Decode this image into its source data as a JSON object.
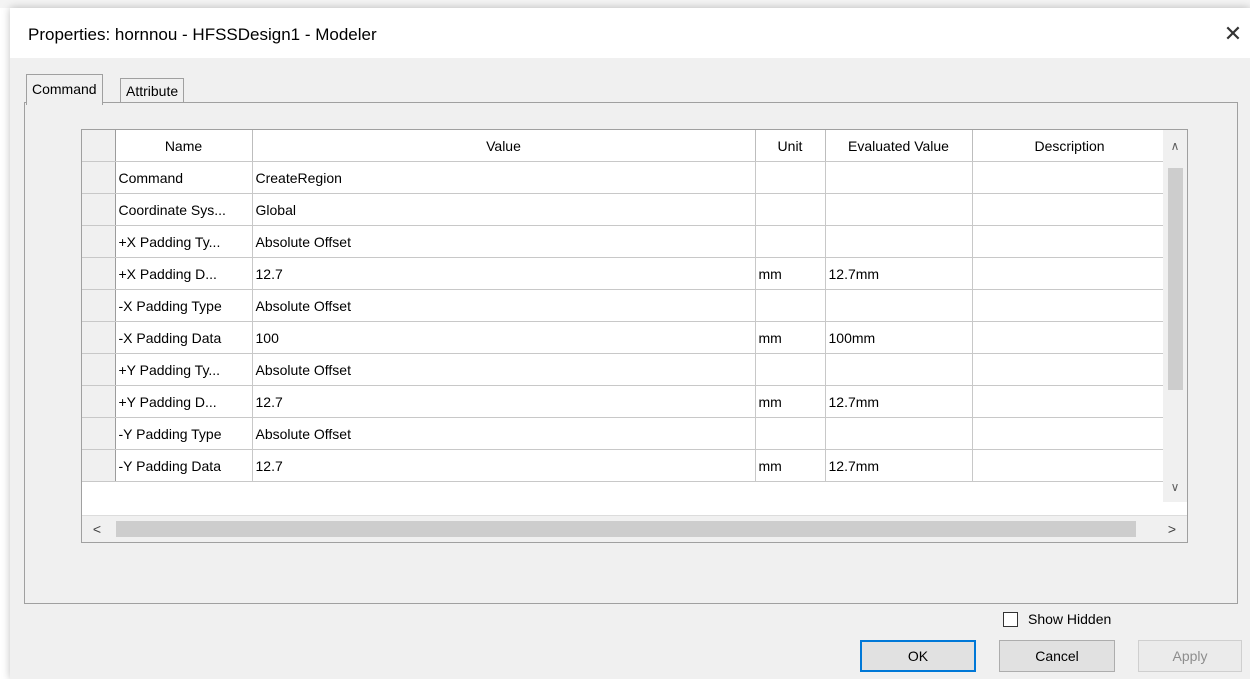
{
  "window": {
    "title": "Properties: hornnou - HFSSDesign1 - Modeler",
    "close_glyph": "✕"
  },
  "tabs": [
    {
      "label": "Command",
      "active": true
    },
    {
      "label": "Attribute",
      "active": false
    }
  ],
  "grid": {
    "columns": [
      "Name",
      "Value",
      "Unit",
      "Evaluated Value",
      "Description"
    ],
    "rows": [
      {
        "name": "Command",
        "value": "CreateRegion",
        "unit": "",
        "evaluated": "",
        "description": ""
      },
      {
        "name": "Coordinate Sys...",
        "value": "Global",
        "unit": "",
        "evaluated": "",
        "description": ""
      },
      {
        "name": "+X Padding Ty...",
        "value": "Absolute Offset",
        "unit": "",
        "evaluated": "",
        "description": ""
      },
      {
        "name": "+X Padding D...",
        "value": "12.7",
        "unit": "mm",
        "evaluated": "12.7mm",
        "description": ""
      },
      {
        "name": "-X Padding Type",
        "value": "Absolute Offset",
        "unit": "",
        "evaluated": "",
        "description": ""
      },
      {
        "name": "-X Padding Data",
        "value": "100",
        "unit": "mm",
        "evaluated": "100mm",
        "description": ""
      },
      {
        "name": "+Y Padding Ty...",
        "value": "Absolute Offset",
        "unit": "",
        "evaluated": "",
        "description": ""
      },
      {
        "name": "+Y Padding D...",
        "value": "12.7",
        "unit": "mm",
        "evaluated": "12.7mm",
        "description": ""
      },
      {
        "name": "-Y Padding Type",
        "value": "Absolute Offset",
        "unit": "",
        "evaluated": "",
        "description": ""
      },
      {
        "name": "-Y Padding Data",
        "value": "12.7",
        "unit": "mm",
        "evaluated": "12.7mm",
        "description": ""
      }
    ]
  },
  "scroll": {
    "up_glyph": "∧",
    "down_glyph": "∨",
    "left_glyph": "<",
    "right_glyph": ">"
  },
  "show_hidden": {
    "label": "Show Hidden",
    "checked": false
  },
  "buttons": {
    "ok": "OK",
    "cancel": "Cancel",
    "apply": "Apply"
  }
}
